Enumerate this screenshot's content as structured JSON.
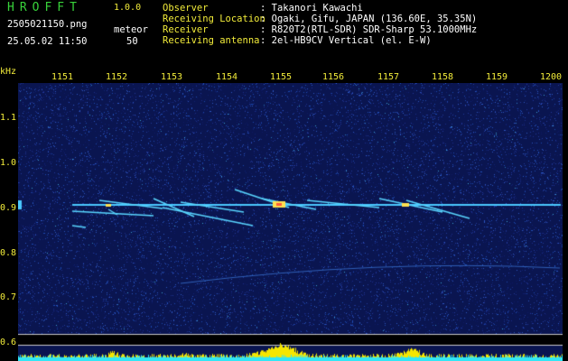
{
  "app": {
    "logo": "HROFFT",
    "version": "1.0.0",
    "filename": "2505021150.png",
    "meteor_label": "meteor",
    "datetime": "25.05.02 11:50",
    "meteor_count": "50"
  },
  "info": [
    {
      "label": "Observer",
      "value": ": Takanori Kawachi"
    },
    {
      "label": "Receiving Location",
      "value": ": Ogaki, Gifu, JAPAN (136.60E, 35.35N)"
    },
    {
      "label": "Receiver",
      "value": ": R820T2(RTL-SDR) SDR-Sharp 53.1000MHz"
    },
    {
      "label": "Receiving antenna",
      "value": ": 2el-HB9CV Vertical (el. E-W)"
    }
  ],
  "axis": {
    "unit": "kHz",
    "x_ticks": [
      "1151",
      "1152",
      "1153",
      "1154",
      "1155",
      "1156",
      "1157",
      "1158",
      "1159",
      "1200"
    ],
    "y_ticks": [
      "1.1",
      "1.0",
      "0.9",
      "0.8",
      "0.7",
      "0.6"
    ]
  },
  "colors": {
    "background": "#000000",
    "label": "#f2ec3a",
    "text": "#ffffff",
    "logo": "#38d23a",
    "spectrum_bar": "#f5e600",
    "spectrum_floor": "#32e6f5",
    "noise_dark": "#0a1550",
    "carrier": "#4ac8ff"
  },
  "icons": [
    "waterfall-spectrogram"
  ]
}
